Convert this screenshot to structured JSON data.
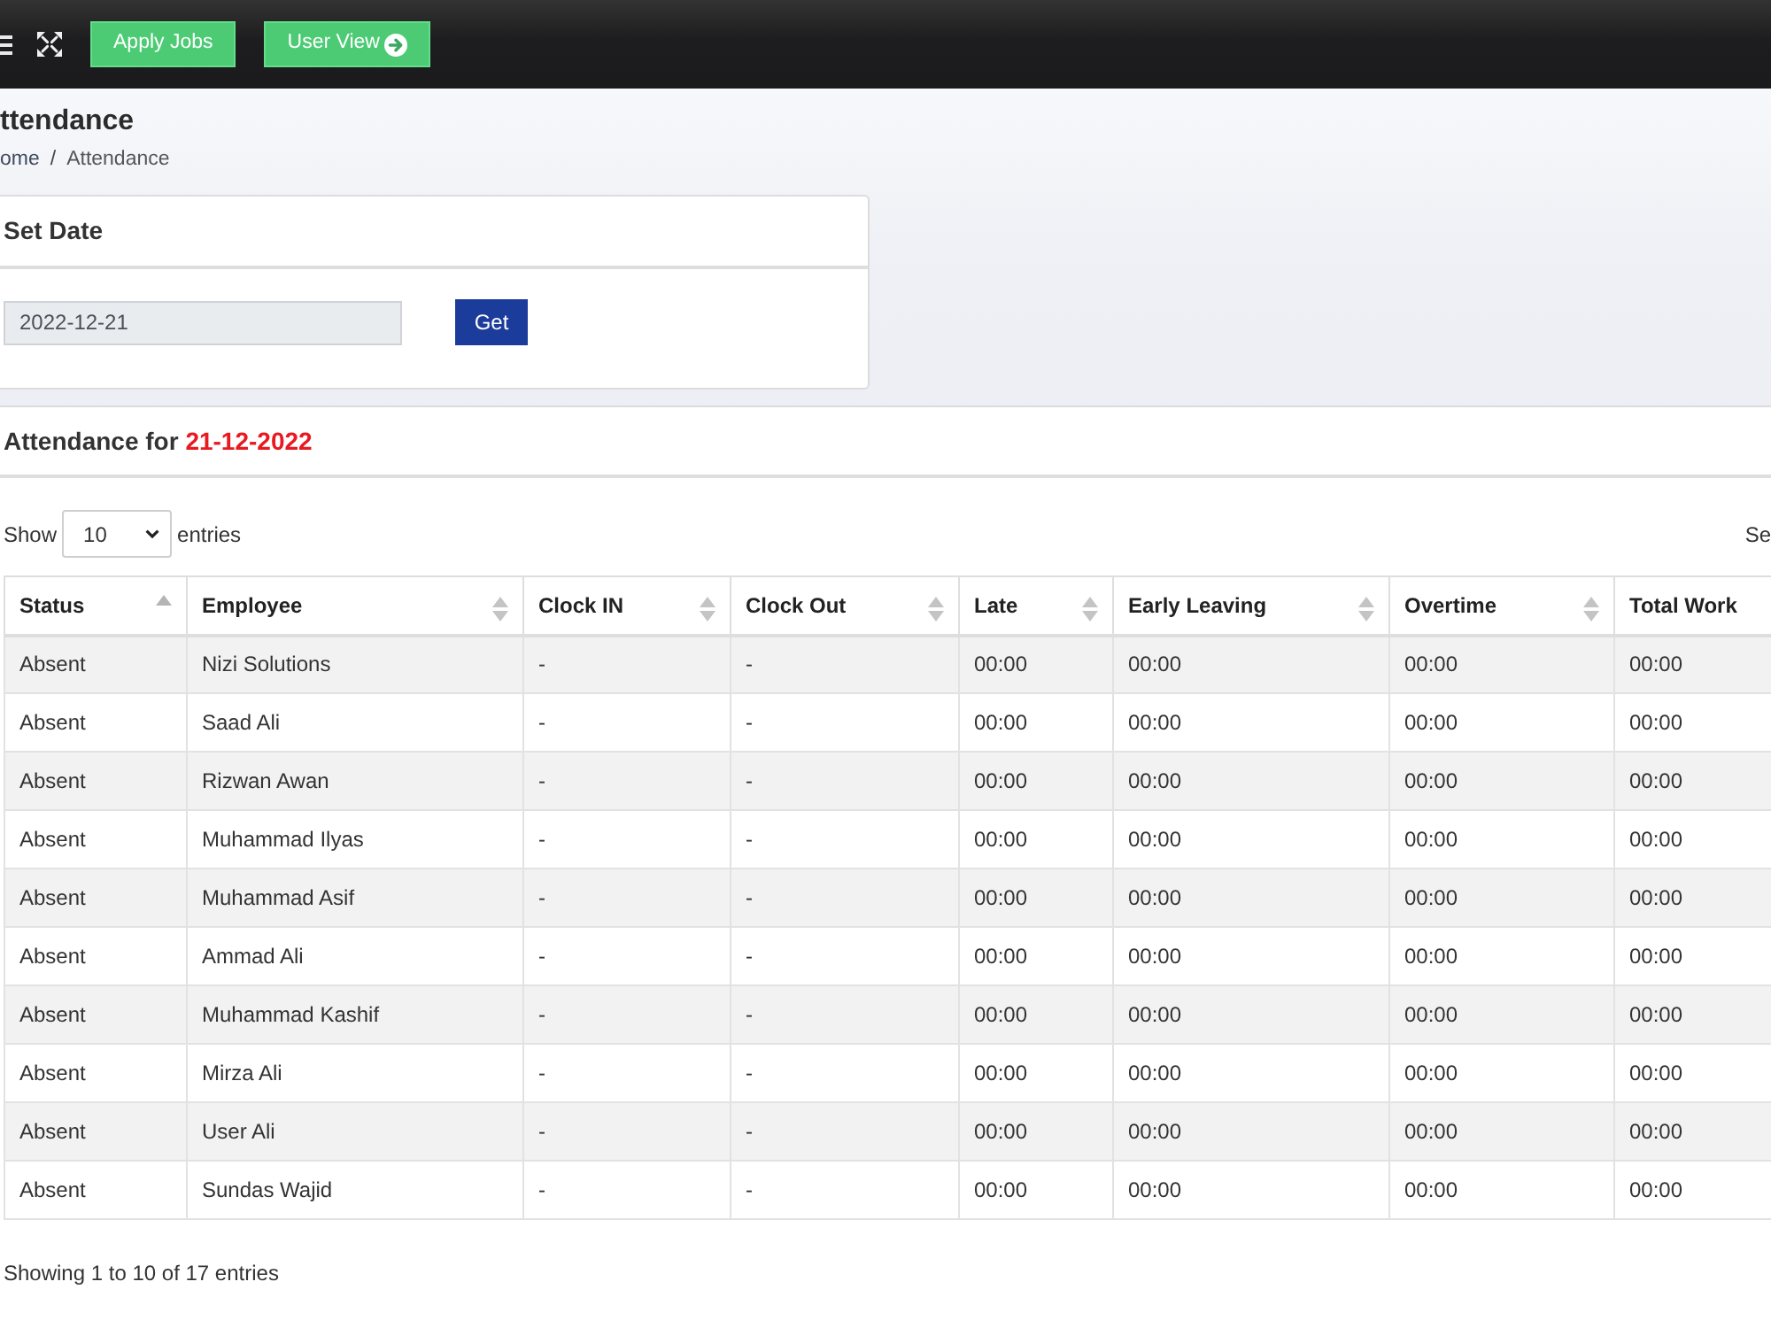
{
  "topbar": {
    "buttons": [
      {
        "label": "Apply Jobs",
        "kind": "plain"
      },
      {
        "label": "User View",
        "kind": "arrow"
      }
    ]
  },
  "page": {
    "title": "ttendance",
    "breadcrumb": {
      "separator": "/",
      "items": [
        {
          "label": "ome",
          "kind": "link"
        },
        {
          "label": "Attendance",
          "kind": "current"
        }
      ]
    }
  },
  "set_date": {
    "title": "Set Date",
    "date_value": "2022-12-21",
    "button": "Get"
  },
  "attendance": {
    "title": "Attendance for",
    "date": "21-12-2022",
    "show_label": "Show",
    "entries_value": "10",
    "entries_label": "entries",
    "search_label": "Se",
    "columns": [
      {
        "label": "Status",
        "sortable": true,
        "sorted": true
      },
      {
        "label": "Employee",
        "sortable": true,
        "sorted": false
      },
      {
        "label": "Clock IN",
        "sortable": true,
        "sorted": false
      },
      {
        "label": "Clock Out",
        "sortable": true,
        "sorted": false
      },
      {
        "label": "Late",
        "sortable": true,
        "sorted": false
      },
      {
        "label": "Early Leaving",
        "sortable": true,
        "sorted": false
      },
      {
        "label": "Overtime",
        "sortable": true,
        "sorted": false
      },
      {
        "label": "Total Work",
        "sortable": false,
        "sorted": false
      }
    ],
    "rows": [
      [
        "Absent",
        "Nizi Solutions",
        "-",
        "-",
        "00:00",
        "00:00",
        "00:00",
        "00:00"
      ],
      [
        "Absent",
        "Saad Ali",
        "-",
        "-",
        "00:00",
        "00:00",
        "00:00",
        "00:00"
      ],
      [
        "Absent",
        "Rizwan Awan",
        "-",
        "-",
        "00:00",
        "00:00",
        "00:00",
        "00:00"
      ],
      [
        "Absent",
        "Muhammad Ilyas",
        "-",
        "-",
        "00:00",
        "00:00",
        "00:00",
        "00:00"
      ],
      [
        "Absent",
        "Muhammad Asif",
        "-",
        "-",
        "00:00",
        "00:00",
        "00:00",
        "00:00"
      ],
      [
        "Absent",
        "Ammad Ali",
        "-",
        "-",
        "00:00",
        "00:00",
        "00:00",
        "00:00"
      ],
      [
        "Absent",
        "Muhammad Kashif",
        "-",
        "-",
        "00:00",
        "00:00",
        "00:00",
        "00:00"
      ],
      [
        "Absent",
        "Mirza Ali",
        "-",
        "-",
        "00:00",
        "00:00",
        "00:00",
        "00:00"
      ],
      [
        "Absent",
        "User Ali",
        "-",
        "-",
        "00:00",
        "00:00",
        "00:00",
        "00:00"
      ],
      [
        "Absent",
        "Sundas Wajid",
        "-",
        "-",
        "00:00",
        "00:00",
        "00:00",
        "00:00"
      ]
    ],
    "info": "Showing 1 to 10 of 17 entries"
  }
}
